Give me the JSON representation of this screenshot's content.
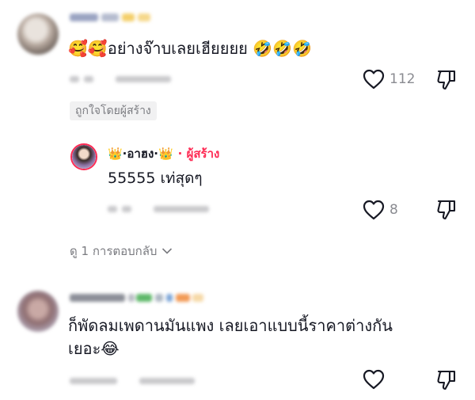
{
  "comments": [
    {
      "text": "🥰🥰อย่างจ๊าบเลยเฮียยยย 🤣🤣🤣",
      "likes": "112"
    },
    {
      "is_reply": true,
      "author": "👑·อาฮง·👑",
      "author_badge": "· ผู้สร้าง",
      "text": "55555 เท่สุดๆ",
      "likes": "8"
    },
    {
      "text_line1": "ก็พัดลมเพดานมันแพง เลยเอาแบบนี้ราคาต่างกัน",
      "text_line2": "เยอะ😂",
      "likes": ""
    }
  ],
  "liked_by_creator": "ถูกใจโดยผู้สร้าง",
  "view_replies": "ดู 1 การตอบกลับ",
  "icons": {
    "like": "heart-outline-icon",
    "dislike": "thumbs-down-outline-icon",
    "expand": "chevron-down-icon"
  },
  "colors": {
    "text": "#161823",
    "muted": "#8a8b91",
    "creator": "#fe2c55",
    "pill_bg": "#f1f1f2"
  }
}
